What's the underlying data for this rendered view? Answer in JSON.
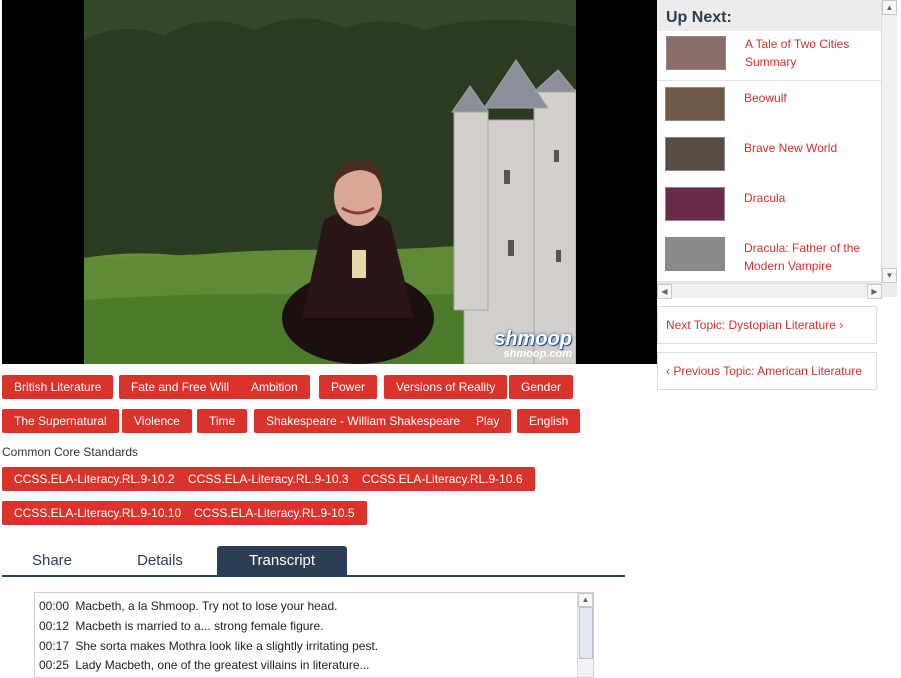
{
  "video": {
    "logo_main": "shmoop",
    "logo_sub": "shmoop.com"
  },
  "up_next": {
    "title": "Up Next:",
    "items": [
      {
        "label": "A Tale of Two Cities Summary"
      },
      {
        "label": "Beowulf"
      },
      {
        "label": "Brave New World"
      },
      {
        "label": "Dracula"
      },
      {
        "label": "Dracula: Father of the Modern Vampire"
      }
    ]
  },
  "topic_nav": {
    "next": "Next Topic: Dystopian Literature",
    "next_icon": "chevron-right-icon",
    "previous": "Previous Topic: American Literature",
    "previous_icon": "chevron-left-icon"
  },
  "tags_row1": [
    "British Literature",
    "Fate and Free Will",
    "Ambition",
    "Power",
    "Versions of Reality",
    "Gender"
  ],
  "tags_row2": [
    "The Supernatural",
    "Violence",
    "Time",
    "Shakespeare - William Shakespeare",
    "Play",
    "English"
  ],
  "standards": {
    "label": "Common Core Standards",
    "row1": [
      "CCSS.ELA-Literacy.RL.9-10.2",
      "CCSS.ELA-Literacy.RL.9-10.3",
      "CCSS.ELA-Literacy.RL.9-10.6"
    ],
    "row2": [
      "CCSS.ELA-Literacy.RL.9-10.10",
      "CCSS.ELA-Literacy.RL.9-10.5"
    ]
  },
  "tabs": [
    {
      "label": "Share"
    },
    {
      "label": "Details"
    },
    {
      "label": "Transcript",
      "active": true
    }
  ],
  "transcript": [
    {
      "time": "00:00",
      "text": "Macbeth, a la Shmoop. Try not to lose your head."
    },
    {
      "time": "00:12",
      "text": "Macbeth is married to a... strong female figure."
    },
    {
      "time": "00:17",
      "text": "She sorta makes Mothra look like a slightly irritating pest."
    },
    {
      "time": "00:25",
      "text": "Lady Macbeth, one of the greatest villains in literature..."
    }
  ],
  "colors": {
    "accent_red": "#d9332b",
    "navy": "#2c3e55",
    "link_red": "#cc3333"
  }
}
